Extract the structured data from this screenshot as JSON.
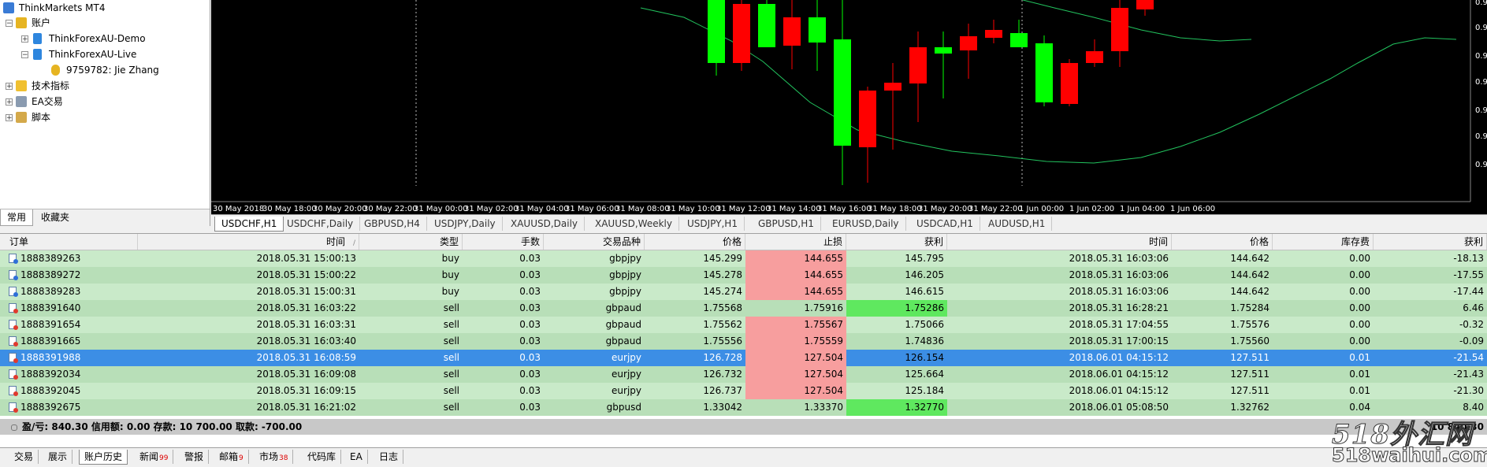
{
  "navigator": {
    "title": "ThinkMarkets MT4",
    "accounts_label": "账户",
    "demo_label": "ThinkForexAU-Demo",
    "live_label": "ThinkForexAU-Live",
    "account_entry": "9759782: Jie Zhang",
    "indicators_label": "技术指标",
    "ea_label": "EA交易",
    "scripts_label": "脚本",
    "tabs": [
      "常用",
      "收藏夹"
    ]
  },
  "chart": {
    "time_labels": [
      "30 May 2018",
      "30 May 18:00",
      "30 May 20:00",
      "30 May 22:00",
      "31 May 00:00",
      "31 May 02:00",
      "31 May 04:00",
      "31 May 06:00",
      "31 May 08:00",
      "31 May 10:00",
      "31 May 12:00",
      "31 May 14:00",
      "31 May 16:00",
      "31 May 18:00",
      "31 May 20:00",
      "31 May 22:00",
      "1 Jun 00:00",
      "1 Jun 02:00",
      "1 Jun 04:00",
      "1 Jun 06:00"
    ],
    "price_labels": [
      "0.9",
      "0.9",
      "0.9",
      "0.9",
      "0.9",
      "0.9",
      "0.9",
      "0.9",
      "0.9",
      "0.9"
    ],
    "colors": {
      "bull": "#00ff00",
      "bear": "#ff0000",
      "ma": "#22c35e"
    }
  },
  "chart_tabs": [
    "USDCHF,H1",
    "USDCHF,Daily",
    "GBPUSD,H4",
    "USDJPY,Daily",
    "XAUUSD,Daily",
    "XAUUSD,Weekly",
    "USDJPY,H1",
    "GBPUSD,H1",
    "EURUSD,Daily",
    "USDCAD,H1",
    "AUDUSD,H1"
  ],
  "table": {
    "headers": [
      "订单",
      "时间",
      "类型",
      "手数",
      "交易品种",
      "价格",
      "止损",
      "获利",
      "时间",
      "价格",
      "库存费",
      "获利"
    ],
    "sort_marker": "/",
    "rows": [
      {
        "order": "1888389263",
        "open_time": "2018.05.31 15:00:13",
        "type": "buy",
        "lots": "0.03",
        "symbol": "gbpjpy",
        "price": "145.299",
        "sl": "144.655",
        "tp": "145.795",
        "close_time": "2018.05.31 16:03:06",
        "close_price": "144.642",
        "swap": "0.00",
        "profit": "-18.13"
      },
      {
        "order": "1888389272",
        "open_time": "2018.05.31 15:00:22",
        "type": "buy",
        "lots": "0.03",
        "symbol": "gbpjpy",
        "price": "145.278",
        "sl": "144.655",
        "tp": "146.205",
        "close_time": "2018.05.31 16:03:06",
        "close_price": "144.642",
        "swap": "0.00",
        "profit": "-17.55"
      },
      {
        "order": "1888389283",
        "open_time": "2018.05.31 15:00:31",
        "type": "buy",
        "lots": "0.03",
        "symbol": "gbpjpy",
        "price": "145.274",
        "sl": "144.655",
        "tp": "146.615",
        "close_time": "2018.05.31 16:03:06",
        "close_price": "144.642",
        "swap": "0.00",
        "profit": "-17.44"
      },
      {
        "order": "1888391640",
        "open_time": "2018.05.31 16:03:22",
        "type": "sell",
        "lots": "0.03",
        "symbol": "gbpaud",
        "price": "1.75568",
        "sl": "1.75916",
        "tp": "1.75286",
        "close_time": "2018.05.31 16:28:21",
        "close_price": "1.75284",
        "swap": "0.00",
        "profit": "6.46"
      },
      {
        "order": "1888391654",
        "open_time": "2018.05.31 16:03:31",
        "type": "sell",
        "lots": "0.03",
        "symbol": "gbpaud",
        "price": "1.75562",
        "sl": "1.75567",
        "tp": "1.75066",
        "close_time": "2018.05.31 17:04:55",
        "close_price": "1.75576",
        "swap": "0.00",
        "profit": "-0.32"
      },
      {
        "order": "1888391665",
        "open_time": "2018.05.31 16:03:40",
        "type": "sell",
        "lots": "0.03",
        "symbol": "gbpaud",
        "price": "1.75556",
        "sl": "1.75559",
        "tp": "1.74836",
        "close_time": "2018.05.31 17:00:15",
        "close_price": "1.75560",
        "swap": "0.00",
        "profit": "-0.09"
      },
      {
        "order": "1888391988",
        "open_time": "2018.05.31 16:08:59",
        "type": "sell",
        "lots": "0.03",
        "symbol": "eurjpy",
        "price": "126.728",
        "sl": "127.504",
        "tp": "126.154",
        "close_time": "2018.06.01 04:15:12",
        "close_price": "127.511",
        "swap": "0.01",
        "profit": "-21.54"
      },
      {
        "order": "1888392034",
        "open_time": "2018.05.31 16:09:08",
        "type": "sell",
        "lots": "0.03",
        "symbol": "eurjpy",
        "price": "126.732",
        "sl": "127.504",
        "tp": "125.664",
        "close_time": "2018.06.01 04:15:12",
        "close_price": "127.511",
        "swap": "0.01",
        "profit": "-21.43"
      },
      {
        "order": "1888392045",
        "open_time": "2018.05.31 16:09:15",
        "type": "sell",
        "lots": "0.03",
        "symbol": "eurjpy",
        "price": "126.737",
        "sl": "127.504",
        "tp": "125.184",
        "close_time": "2018.06.01 04:15:12",
        "close_price": "127.511",
        "swap": "0.01",
        "profit": "-21.30"
      },
      {
        "order": "1888392675",
        "open_time": "2018.05.31 16:21:02",
        "type": "sell",
        "lots": "0.03",
        "symbol": "gbpusd",
        "price": "1.33042",
        "sl": "1.33370",
        "tp": "1.32770",
        "close_time": "2018.06.01 05:08:50",
        "close_price": "1.32762",
        "swap": "0.04",
        "profit": "8.40"
      }
    ],
    "summary": "盈/亏: 840.30  信用额: 0.00  存款: 10 700.00  取款: -700.00",
    "summary_right": "10 840.30"
  },
  "bottom_tabs": [
    {
      "label": "交易",
      "badge": ""
    },
    {
      "label": "展示",
      "badge": ""
    },
    {
      "label": "账户历史",
      "badge": ""
    },
    {
      "label": "新闻",
      "badge": "99"
    },
    {
      "label": "警报",
      "badge": ""
    },
    {
      "label": "邮箱",
      "badge": "9"
    },
    {
      "label": "市场",
      "badge": "38"
    },
    {
      "label": "代码库",
      "badge": ""
    },
    {
      "label": "EA",
      "badge": ""
    },
    {
      "label": "日志",
      "badge": ""
    }
  ],
  "watermark": {
    "line1": "518外汇网",
    "line2": "518waihui.com"
  }
}
